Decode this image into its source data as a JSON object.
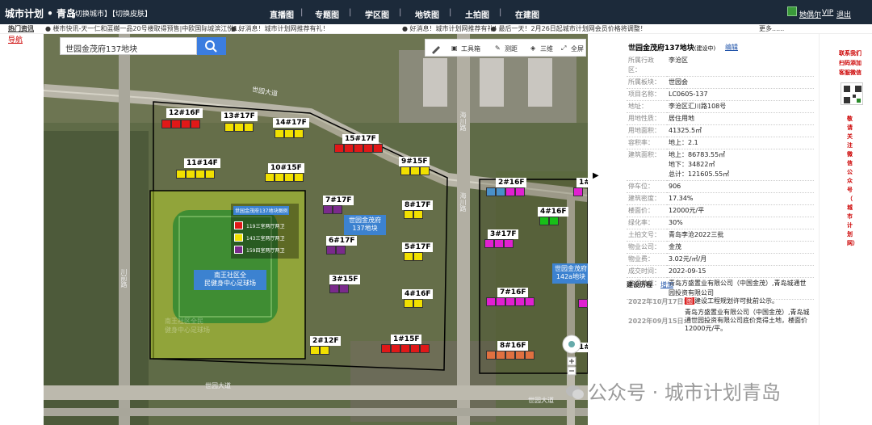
{
  "topbar": {
    "brand": "城市计划 • 青岛",
    "switch_city": "【切换城市】",
    "switch_skin": "【切换皮肤】",
    "nav": [
      "直播图",
      "专题图",
      "学区图",
      "地铁图",
      "土拍图",
      "在建图"
    ],
    "user": "她偶尔",
    "vip": "VIP",
    "logout": "退出"
  },
  "ticker": {
    "label": "热门资讯",
    "items": [
      "● 楼市快讯-天一仁和蓝樾一品20号楼取得预售|中欧国际城滨江悦1...",
      "● 好消息！城市计划网推荐有礼！",
      "● 好消息！城市计划网推荐有礼！",
      "● 最后一天！2月26日起城市计划网会员价格将调整！",
      "更多......"
    ]
  },
  "leftstrip": {
    "nav": "导航"
  },
  "search": {
    "value": "世园金茂府137地块",
    "icon": "search-icon"
  },
  "toolbar": {
    "tools": "工具箱",
    "measure": "测距",
    "three_d": "三维",
    "fullscreen": "全屏"
  },
  "map": {
    "roads": [
      "世园大道",
      "世园大道",
      "世园大道",
      "海川路",
      "海川路",
      "川前路"
    ],
    "lots": [
      {
        "label": "12#16F"
      },
      {
        "label": "13#17F"
      },
      {
        "label": "14#17F"
      },
      {
        "label": "15#17F"
      },
      {
        "label": "11#14F"
      },
      {
        "label": "10#15F"
      },
      {
        "label": "9#15F"
      },
      {
        "label": "7#17F"
      },
      {
        "label": "8#17F"
      },
      {
        "label": "6#17F"
      },
      {
        "label": "5#17F"
      },
      {
        "label": "3#15F"
      },
      {
        "label": "4#16F"
      },
      {
        "label": "2#12F"
      },
      {
        "label": "1#15F"
      },
      {
        "label": "2#16F"
      },
      {
        "label": "1#"
      },
      {
        "label": "4#16F"
      },
      {
        "label": "3#17F"
      },
      {
        "label": "7#16F"
      },
      {
        "label": "8#16F"
      },
      {
        "label": "1#"
      }
    ],
    "tags": {
      "plot137": "世园金茂府\n137地块",
      "plot142": "世园金茂府\n142a地块",
      "stadium": "南王社区全\n民健身中心足球场",
      "stadium_faint": "南王社区全民\n健身中心足球场"
    },
    "legend": {
      "title": "世园金茂府137地块图例",
      "rows": [
        {
          "text": "119三室两厅两卫",
          "color": "#e01818"
        },
        {
          "text": "143三室两厅两卫",
          "color": "#f1e000"
        },
        {
          "text": "159四室两厅两卫",
          "color": "#7a2a8c"
        }
      ]
    }
  },
  "panel": {
    "title": "世园金茂府137地块",
    "title_note": "(建设中)",
    "edit": "编辑",
    "rows": [
      {
        "k": "所属行政区：",
        "v": "李沧区"
      },
      {
        "k": "所属板块：",
        "v": "世园会"
      },
      {
        "k": "项目名称：",
        "v": "LC0605-137"
      },
      {
        "k": "地址：",
        "v": "李沧区汇川路108号"
      },
      {
        "k": "用地性质：",
        "v": "居住用地"
      },
      {
        "k": "用地面积：",
        "v": "41325.5㎡"
      },
      {
        "k": "容积率：",
        "v": "地上：2.1"
      },
      {
        "k": "建筑面积：",
        "v": "地上：86783.55㎡\n地下：34822㎡\n总计：121605.55㎡"
      },
      {
        "k": "停车位：",
        "v": "906"
      },
      {
        "k": "建筑密度：",
        "v": "17.34%"
      },
      {
        "k": "楼面价：",
        "v": "12000元/平"
      },
      {
        "k": "绿化率：",
        "v": "30%"
      },
      {
        "k": "土拍文号：",
        "v": "青岛李沧2022三批"
      },
      {
        "k": "物业公司：",
        "v": "金茂"
      },
      {
        "k": "物业费：",
        "v": "3.02元/㎡/月"
      },
      {
        "k": "成交时间：",
        "v": "2022-09-15"
      },
      {
        "k": "竞得单位：",
        "v": "青岛方盛置业有限公司（中国金茂）,青岛城通世园投资有限公司"
      }
    ],
    "history_title": "建设历程",
    "history_add": "增加",
    "history": [
      {
        "date": "2022年10月17日:",
        "badge": "图",
        "text": "建设工程规划许可批前公示。"
      },
      {
        "date": "2022年09月15日:",
        "badge": "",
        "text": "青岛方盛置业有限公司（中国金茂）,青岛城通世园投资有限公司底价竞得土地，楼面价12000元/平。"
      }
    ]
  },
  "watermark": "公众号 · 城市计划青岛",
  "rightstrip": {
    "contact": "联系我们\n扫码添加\n客服微信",
    "vertical": "敬请关注微信公众号（城市计划网）"
  }
}
